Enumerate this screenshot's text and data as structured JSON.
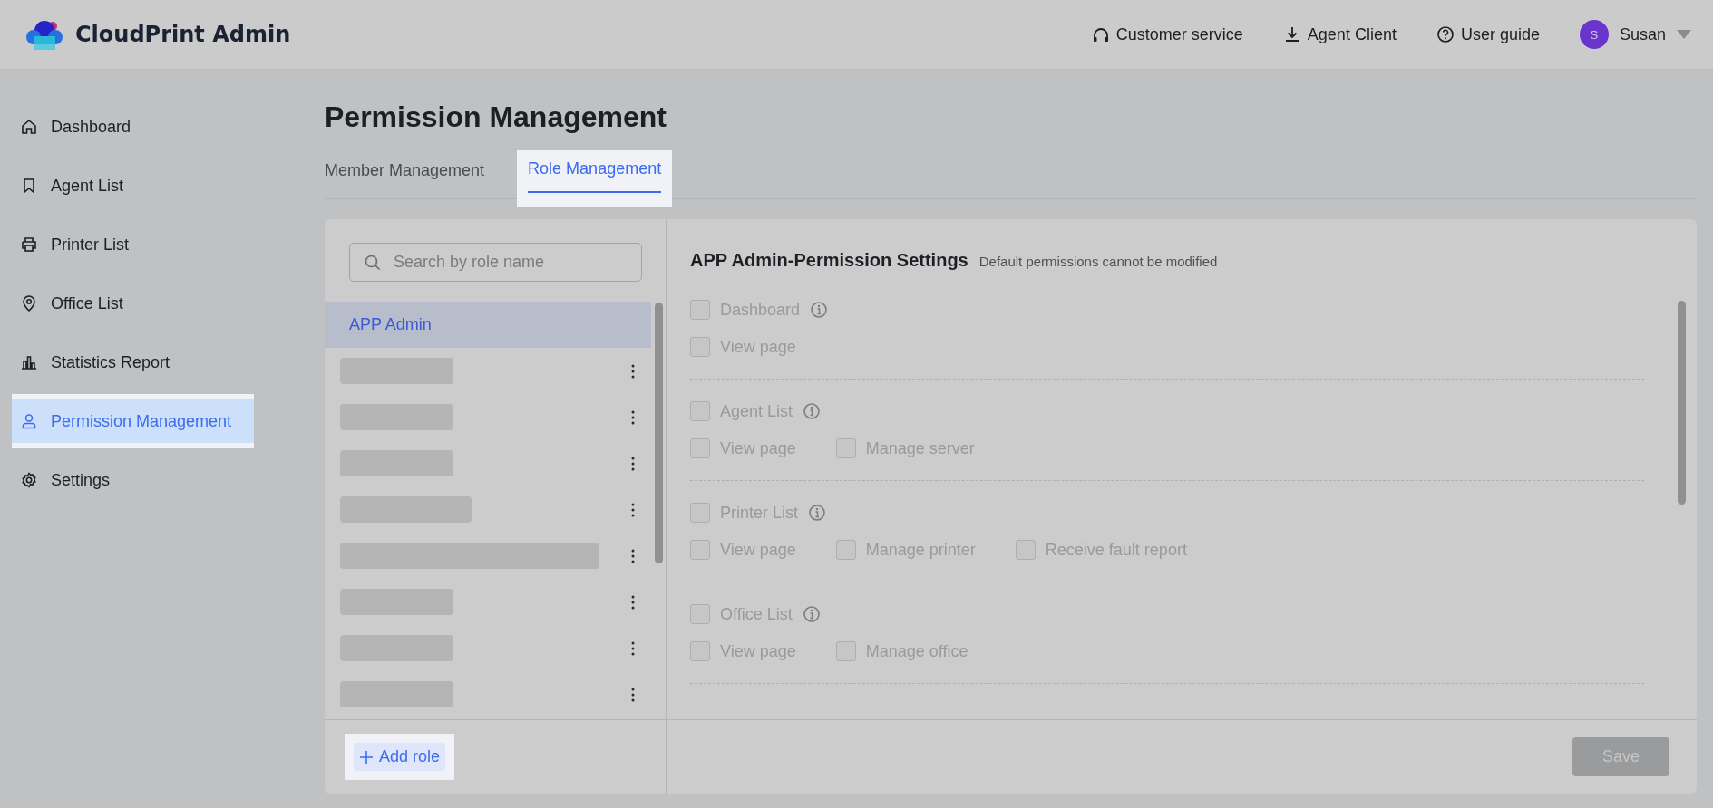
{
  "header": {
    "brand": "CloudPrint Admin",
    "links": [
      {
        "label": "Customer service"
      },
      {
        "label": "Agent Client"
      },
      {
        "label": "User guide"
      }
    ],
    "user": {
      "initial": "S",
      "name": "Susan"
    }
  },
  "sidebar": {
    "items": [
      {
        "label": "Dashboard",
        "selected": false,
        "highlighted": false
      },
      {
        "label": "Agent List",
        "selected": false,
        "highlighted": false
      },
      {
        "label": "Printer List",
        "selected": false,
        "highlighted": false
      },
      {
        "label": "Office List",
        "selected": false,
        "highlighted": false
      },
      {
        "label": "Statistics Report",
        "selected": false,
        "highlighted": false
      },
      {
        "label": "Permission Management",
        "selected": true,
        "highlighted": true
      },
      {
        "label": "Settings",
        "selected": false,
        "highlighted": false
      }
    ]
  },
  "page": {
    "title": "Permission Management",
    "tabs": [
      {
        "label": "Member Management",
        "selected": false,
        "highlighted": false
      },
      {
        "label": "Role Management",
        "selected": true,
        "highlighted": true
      }
    ]
  },
  "roles": {
    "search": {
      "placeholder": "Search by role name"
    },
    "items": [
      {
        "kind": "named",
        "name": "APP Admin",
        "selected": true
      },
      {
        "kind": "redacted",
        "selected": false
      },
      {
        "kind": "redacted",
        "selected": false
      },
      {
        "kind": "redacted",
        "selected": false
      },
      {
        "kind": "redacted",
        "selected": false
      },
      {
        "kind": "redacted",
        "selected": false
      },
      {
        "kind": "redacted",
        "selected": false
      },
      {
        "kind": "redacted",
        "selected": false
      },
      {
        "kind": "redacted",
        "selected": false
      }
    ],
    "add_button": {
      "label": "Add role",
      "highlighted": true
    }
  },
  "permissions": {
    "title": "APP Admin-Permission Settings",
    "note": "Default permissions cannot be modified",
    "sections": [
      {
        "label": "Dashboard",
        "checked": false,
        "disabled": true,
        "options": [
          {
            "label": "View page",
            "checked": false,
            "disabled": true
          }
        ]
      },
      {
        "label": "Agent List",
        "checked": false,
        "disabled": true,
        "options": [
          {
            "label": "View page",
            "checked": false,
            "disabled": true
          },
          {
            "label": "Manage server",
            "checked": false,
            "disabled": true
          }
        ]
      },
      {
        "label": "Printer List",
        "checked": false,
        "disabled": true,
        "options": [
          {
            "label": "View page",
            "checked": false,
            "disabled": true
          },
          {
            "label": "Manage printer",
            "checked": false,
            "disabled": true
          },
          {
            "label": "Receive fault report",
            "checked": false,
            "disabled": true
          }
        ]
      },
      {
        "label": "Office List",
        "checked": false,
        "disabled": true,
        "options": [
          {
            "label": "View page",
            "checked": false,
            "disabled": true
          },
          {
            "label": "Manage office",
            "checked": false,
            "disabled": true
          }
        ]
      }
    ],
    "save_button": {
      "label": "Save",
      "disabled": true
    }
  }
}
